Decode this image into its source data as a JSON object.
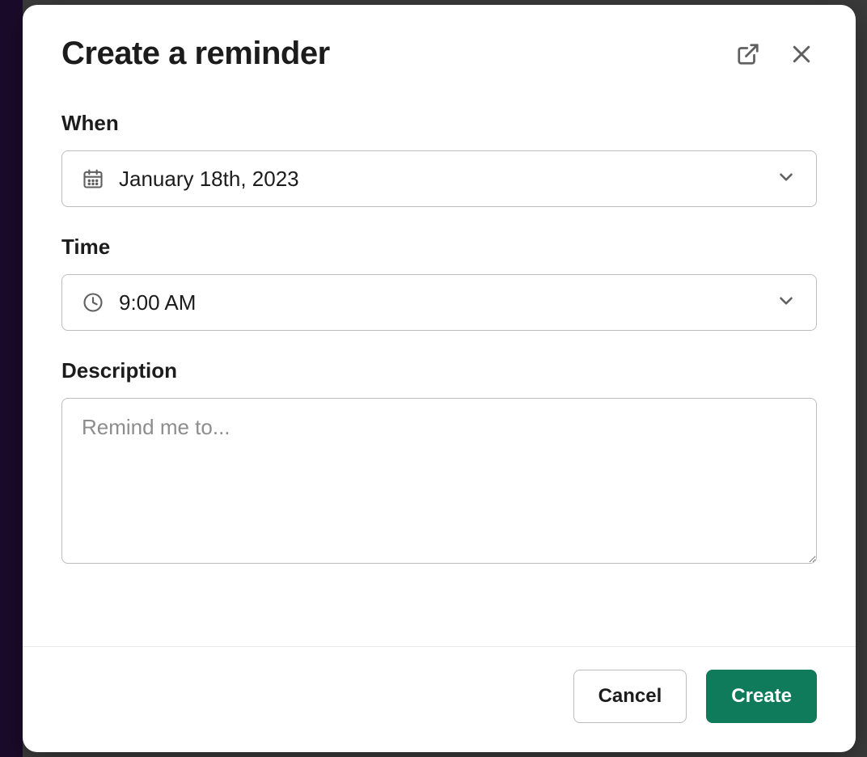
{
  "modal": {
    "title": "Create a reminder",
    "fields": {
      "when": {
        "label": "When",
        "value": "January 18th, 2023"
      },
      "time": {
        "label": "Time",
        "value": "9:00 AM"
      },
      "description": {
        "label": "Description",
        "placeholder": "Remind me to...",
        "value": ""
      }
    },
    "buttons": {
      "cancel": "Cancel",
      "create": "Create"
    }
  }
}
